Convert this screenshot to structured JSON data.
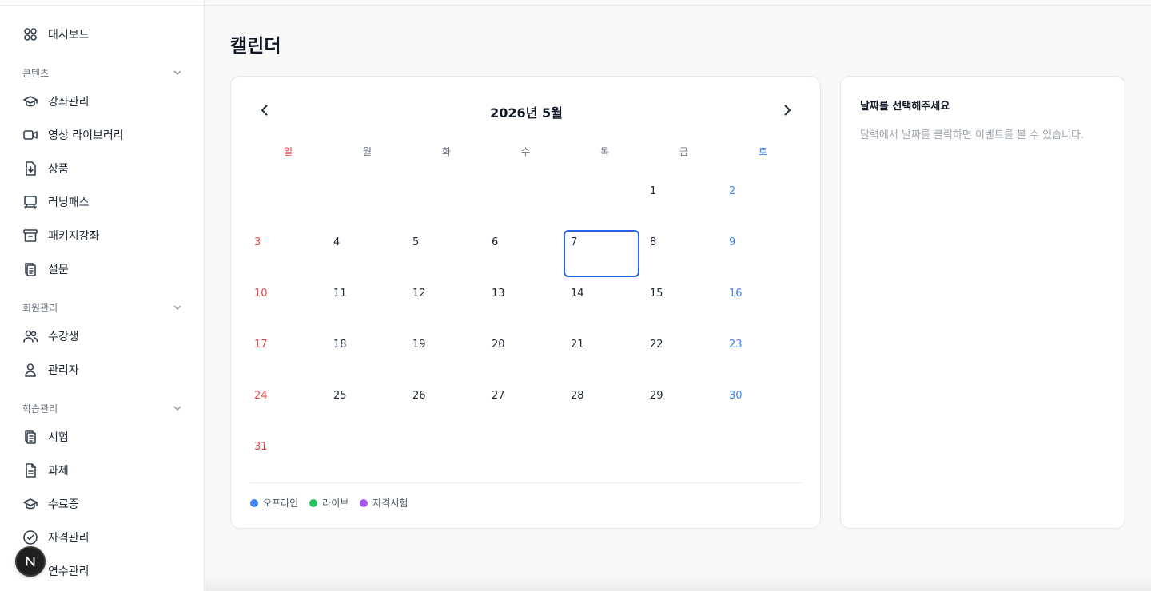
{
  "sidebar": {
    "items": [
      {
        "label": "대시보드",
        "icon": "dashboard-grid-icon"
      },
      {
        "label": "강좌관리",
        "icon": "graduation-cap-icon"
      },
      {
        "label": "영상 라이브러리",
        "icon": "video-camera-icon"
      },
      {
        "label": "상품",
        "icon": "file-download-icon"
      },
      {
        "label": "러닝패스",
        "icon": "presentation-board-icon"
      },
      {
        "label": "패키지강좌",
        "icon": "archive-box-icon"
      },
      {
        "label": "설문",
        "icon": "clipboard-copy-icon"
      },
      {
        "label": "수강생",
        "icon": "users-icon"
      },
      {
        "label": "관리자",
        "icon": "user-icon"
      },
      {
        "label": "시험",
        "icon": "clipboard-copy-icon"
      },
      {
        "label": "과제",
        "icon": "document-icon"
      },
      {
        "label": "수료증",
        "icon": "graduation-cap-icon"
      },
      {
        "label": "자격관리",
        "icon": "check-circle-icon"
      },
      {
        "label": "연수관리",
        "icon": "training-icon"
      }
    ],
    "sections": [
      {
        "label": "콘텐츠"
      },
      {
        "label": "회원관리"
      },
      {
        "label": "학습관리"
      }
    ]
  },
  "page": {
    "title": "캘린더"
  },
  "calendar": {
    "month_title": "2026년 5월",
    "weekdays": [
      "일",
      "월",
      "화",
      "수",
      "목",
      "금",
      "토"
    ],
    "first_weekday_index": 5,
    "days": [
      "1",
      "2",
      "3",
      "4",
      "5",
      "6",
      "7",
      "8",
      "9",
      "10",
      "11",
      "12",
      "13",
      "14",
      "15",
      "16",
      "17",
      "18",
      "19",
      "20",
      "21",
      "22",
      "23",
      "24",
      "25",
      "26",
      "27",
      "28",
      "29",
      "30",
      "31"
    ],
    "selected_day": "7",
    "colors": {
      "sunday": "#ef4444",
      "saturday": "#3b82f6",
      "selected_border": "#2563eb"
    }
  },
  "legend": [
    {
      "label": "오프라인",
      "color": "#3b82f6"
    },
    {
      "label": "라이브",
      "color": "#22c55e"
    },
    {
      "label": "자격시험",
      "color": "#a855f7"
    }
  ],
  "side_panel": {
    "title": "날짜를 선택해주세요",
    "description": "달력에서 날짜를 클릭하면 이벤트를 볼 수 있습니다."
  }
}
